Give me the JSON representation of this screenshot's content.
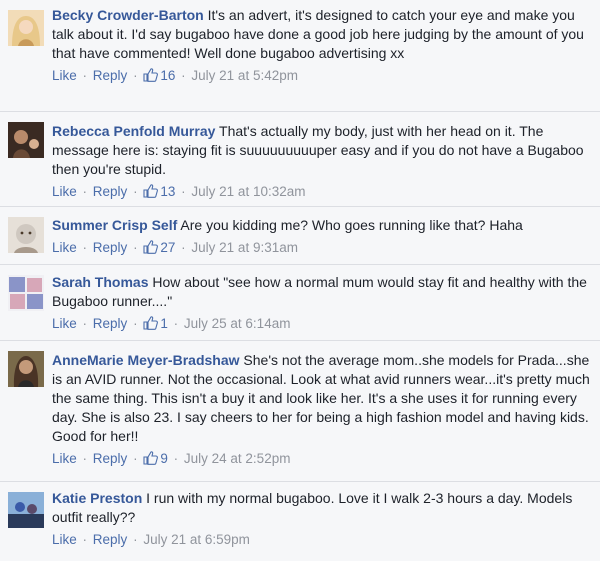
{
  "actions": {
    "like": "Like",
    "reply": "Reply",
    "separator": "·"
  },
  "comments": [
    {
      "author": "Becky Crowder-Barton",
      "text": "It's an advert, it's designed to catch your eye and make you talk about it. I'd say bugaboo have done a good job here judging by the amount of you that have commented! Well done bugaboo advertising xx",
      "likes": "16",
      "time": "July 21 at 5:42pm",
      "avatar_colors": [
        "#e8c88a",
        "#c89a5a",
        "#f2dcb8"
      ]
    },
    {
      "author": "Rebecca Penfold Murray",
      "text": "That's actually my body, just with her head on it. The message here is: staying fit is suuuuuuuuuper easy and if you do not have a Bugaboo then you're stupid.",
      "likes": "13",
      "time": "July 21 at 10:32am",
      "avatar_colors": [
        "#6a4a36",
        "#b98a6a",
        "#3a2a22"
      ]
    },
    {
      "author": "Summer Crisp Self",
      "text": "Are you kidding me? Who goes running like that? Haha",
      "likes": "27",
      "time": "July 21 at 9:31am",
      "avatar_colors": [
        "#cfc8c0",
        "#a89a8c",
        "#e6e0d8"
      ]
    },
    {
      "author": "Sarah Thomas",
      "text": "How about \"see how a normal mum would stay fit and healthy with the Bugaboo runner....\"",
      "likes": "1",
      "time": "July 25 at 6:14am",
      "avatar_colors": [
        "#8a94c8",
        "#d7a7b8",
        "#f0f0f4"
      ]
    },
    {
      "author": "AnneMarie Meyer-Bradshaw",
      "text": "She's not the average mom..she models for Prada...she is an AVID runner. Not the occasional. Look at what avid runners wear...it's pretty much the same thing. This isn't a buy it and look like her. It's a she uses it for running every day. She is also 23. I say cheers to her for being a high fashion model and having kids. Good for her!!",
      "likes": "9",
      "time": "July 24 at 2:52pm",
      "avatar_colors": [
        "#4a3426",
        "#c49a7a",
        "#7a6a4a"
      ]
    },
    {
      "author": "Katie Preston",
      "text": "I run with my normal bugaboo. Love it I walk 2-3 hours a day. Models outfit really??",
      "likes": "",
      "time": "July 21 at 6:59pm",
      "avatar_colors": [
        "#3a5aa8",
        "#8ab0d8",
        "#2a3a5a"
      ]
    }
  ]
}
